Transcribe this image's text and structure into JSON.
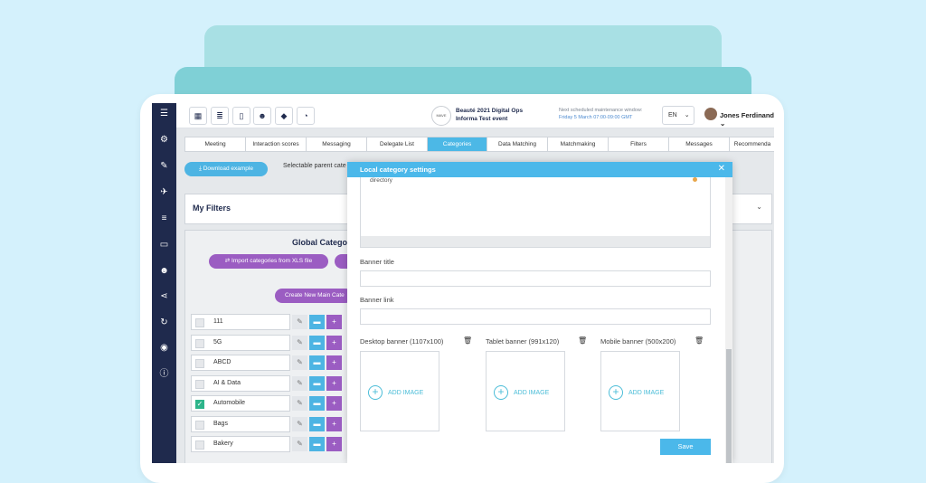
{
  "topbar": {
    "event_logo_text": "MAVE",
    "event_name": "Beauté 2021 Digital Ops",
    "event_sub": "Informa Test event",
    "maintenance_label": "Next scheduled maintenance window:",
    "maintenance_time": "Friday 5 March 07:00-09:00 GMT",
    "language": "EN",
    "user_name": "Jones Ferdinand"
  },
  "tabs": [
    "Meeting",
    "Interaction scores",
    "Messaging",
    "Delegate List",
    "Categories",
    "Data Matching",
    "Matchmaking",
    "Filters",
    "Messages",
    "Recommenda"
  ],
  "active_tab": "Categories",
  "actions": {
    "download_label": "Download example",
    "parent_text": "Selectable parent cate"
  },
  "filters": {
    "title": "My Filters"
  },
  "global": {
    "title": "Global Catego",
    "import_label": "Import categories from XLS file",
    "create_label": "Create New Main Cate"
  },
  "categories": [
    {
      "label": "111",
      "checked": false
    },
    {
      "label": "5G",
      "checked": false
    },
    {
      "label": "ABCD",
      "checked": false
    },
    {
      "label": "AI & Data",
      "checked": false
    },
    {
      "label": "Automobile",
      "checked": true
    },
    {
      "label": "Bags",
      "checked": false
    },
    {
      "label": "Bakery",
      "checked": false
    }
  ],
  "modal": {
    "title": "Local category settings",
    "textarea_value": "directory",
    "banner_title_label": "Banner title",
    "banner_link_label": "Banner link",
    "desktop_banner_label": "Desktop banner (1107x100)",
    "tablet_banner_label": "Tablet banner (991x120)",
    "mobile_banner_label": "Mobile banner (500x200)",
    "add_image_label": "ADD IMAGE",
    "save_label": "Save"
  },
  "colors": {
    "sidebar": "#1f2a4d",
    "accent_blue": "#4bb8ea",
    "accent_purple": "#9b5dc2",
    "check_green": "#2db48a"
  }
}
